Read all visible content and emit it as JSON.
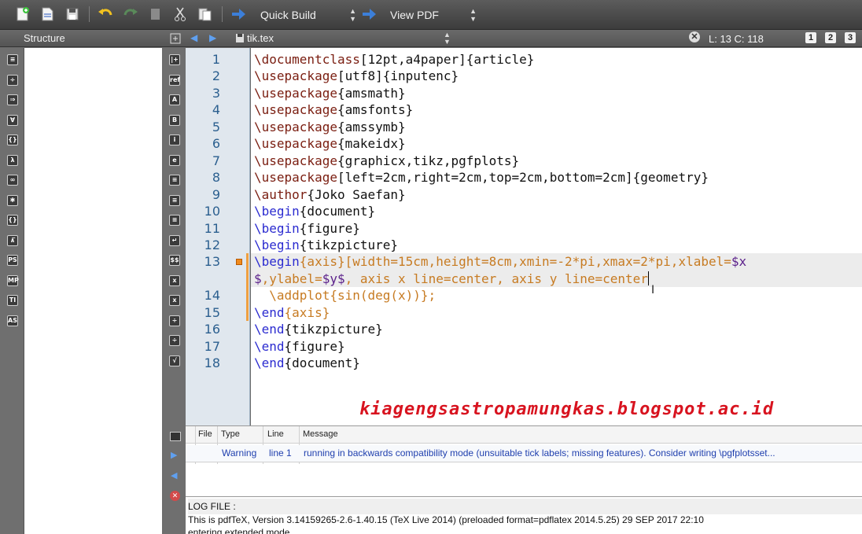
{
  "toolbar": {
    "build_command": "Quick Build",
    "view_command": "View PDF",
    "icons": [
      "new-file-icon",
      "new-from-template-icon",
      "save-icon",
      "undo-icon",
      "redo-icon",
      "copy-icon",
      "cut-icon",
      "paste-icon",
      "run-arrow-icon"
    ]
  },
  "structure": {
    "title": "Structure",
    "tool_icons": [
      "≡",
      "÷",
      "⇒",
      "∀",
      "{}",
      "λ",
      "∞",
      "✱",
      "{}",
      "∧̅",
      "PS",
      "MP",
      "TI",
      "AS"
    ]
  },
  "editor": {
    "file_name": "tik.tex",
    "position": "L: 13 C: 118",
    "view_buttons": [
      "1",
      "2",
      "3"
    ],
    "side_icons": [
      "|+",
      "ref",
      "A",
      "B",
      "i",
      "e",
      "≡",
      "≡",
      "≡",
      "↵",
      "$$",
      "x",
      "x",
      "÷",
      "÷",
      "√"
    ],
    "lines": [
      {
        "num": "1",
        "segments": [
          {
            "t": "\\documentclass",
            "c": "kw"
          },
          {
            "t": "[12pt,a4paper]{article}",
            "c": ""
          }
        ]
      },
      {
        "num": "2",
        "segments": [
          {
            "t": "\\usepackage",
            "c": "kw"
          },
          {
            "t": "[utf8]{inputenc}",
            "c": ""
          }
        ]
      },
      {
        "num": "3",
        "segments": [
          {
            "t": "\\usepackage",
            "c": "kw"
          },
          {
            "t": "{amsmath}",
            "c": ""
          }
        ]
      },
      {
        "num": "4",
        "segments": [
          {
            "t": "\\usepackage",
            "c": "kw"
          },
          {
            "t": "{amsfonts}",
            "c": ""
          }
        ]
      },
      {
        "num": "5",
        "segments": [
          {
            "t": "\\usepackage",
            "c": "kw"
          },
          {
            "t": "{amssymb}",
            "c": ""
          }
        ]
      },
      {
        "num": "6",
        "segments": [
          {
            "t": "\\usepackage",
            "c": "kw"
          },
          {
            "t": "{makeidx}",
            "c": ""
          }
        ]
      },
      {
        "num": "7",
        "segments": [
          {
            "t": "\\usepackage",
            "c": "kw"
          },
          {
            "t": "{graphicx,tikz,pgfplots}",
            "c": ""
          }
        ]
      },
      {
        "num": "8",
        "segments": [
          {
            "t": "\\usepackage",
            "c": "kw"
          },
          {
            "t": "[left=2cm,right=2cm,top=2cm,bottom=2cm]{geometry}",
            "c": ""
          }
        ]
      },
      {
        "num": "9",
        "segments": [
          {
            "t": "\\author",
            "c": "kw"
          },
          {
            "t": "{Joko Saefan}",
            "c": ""
          }
        ]
      },
      {
        "num": "10",
        "segments": [
          {
            "t": "\\begin",
            "c": "kw2"
          },
          {
            "t": "{document}",
            "c": ""
          }
        ]
      },
      {
        "num": "11",
        "segments": [
          {
            "t": "\\begin",
            "c": "kw2"
          },
          {
            "t": "{figure}",
            "c": ""
          }
        ]
      },
      {
        "num": "12",
        "segments": [
          {
            "t": "\\begin",
            "c": "kw2"
          },
          {
            "t": "{tikzpicture}",
            "c": ""
          }
        ]
      },
      {
        "num": "13",
        "segments": [
          {
            "t": "\\begin",
            "c": "kw2"
          },
          {
            "t": "{axis}[width=15cm,height=8cm,xmin=-2*pi,xmax=2*pi,xlabel=",
            "c": "env"
          },
          {
            "t": "$x",
            "c": "mth"
          }
        ]
      },
      {
        "num": "",
        "segments": [
          {
            "t": "$",
            "c": "mth"
          },
          {
            "t": ",ylabel=",
            "c": "env"
          },
          {
            "t": "$y$",
            "c": "mth"
          },
          {
            "t": ", axis x line=center, axis y line=center",
            "c": "env"
          }
        ]
      },
      {
        "num": "14",
        "segments": [
          {
            "t": "  \\addplot{sin(deg(x))};",
            "c": "env"
          }
        ]
      },
      {
        "num": "15",
        "segments": [
          {
            "t": "\\end",
            "c": "kw2"
          },
          {
            "t": "{axis}",
            "c": "env"
          }
        ]
      },
      {
        "num": "16",
        "segments": [
          {
            "t": "\\end",
            "c": "kw2"
          },
          {
            "t": "{tikzpicture}",
            "c": ""
          }
        ]
      },
      {
        "num": "17",
        "segments": [
          {
            "t": "\\end",
            "c": "kw2"
          },
          {
            "t": "{figure}",
            "c": ""
          }
        ]
      },
      {
        "num": "18",
        "segments": [
          {
            "t": "\\end",
            "c": "kw2"
          },
          {
            "t": "{document}",
            "c": ""
          }
        ]
      }
    ],
    "watermark": "kiagengsastropamungkas.blogspot.ac.id"
  },
  "messages": {
    "headers": {
      "file": "File",
      "type": "Type",
      "line": "Line",
      "message": "Message"
    },
    "row": {
      "file": "",
      "type": "Warning",
      "line": "line 1",
      "message": "running in backwards compatibility mode (unsuitable tick labels; missing features). Consider writing \\pgfplotsset..."
    }
  },
  "log": {
    "title": "LOG FILE :",
    "lines": [
      "This is pdfTeX, Version 3.14159265-2.6-1.40.15 (TeX Live 2014) (preloaded format=pdflatex 2014.5.25) 29 SEP 2017 22:10",
      "entering extended mode"
    ]
  },
  "colors": {
    "keyword": "#7a1d10",
    "environment": "#2b2bd0",
    "option": "#c77b22",
    "math": "#5a1f8a",
    "watermark": "#d8131f"
  }
}
